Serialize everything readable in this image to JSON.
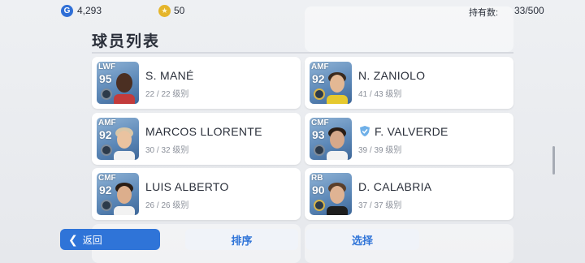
{
  "topbar": {
    "gp_icon": "G",
    "gp_value": "4,293",
    "coin_icon": "star-coin",
    "coin_value": "50",
    "holdings_label": "持有数:",
    "holdings_value": "33/500"
  },
  "title": "球员列表",
  "players": [
    {
      "pos": "LWF",
      "ovr": "95",
      "name": "S. MANÉ",
      "level": "22 / 22 级别",
      "badge": "silver"
    },
    {
      "pos": "AMF",
      "ovr": "92",
      "name": "N. ZANIOLO",
      "level": "41 / 43 级别",
      "badge": "gold"
    },
    {
      "pos": "AMF",
      "ovr": "92",
      "name": "MARCOS LLORENTE",
      "level": "30 / 32 级别",
      "badge": "silver"
    },
    {
      "pos": "CMF",
      "ovr": "93",
      "name": "F. VALVERDE",
      "level": "39 / 39 级别",
      "badge": "silver",
      "checked": true
    },
    {
      "pos": "CMF",
      "ovr": "92",
      "name": "LUIS ALBERTO",
      "level": "26 / 26 级别",
      "badge": "silver"
    },
    {
      "pos": "RB",
      "ovr": "90",
      "name": "D. CALABRIA",
      "level": "37 / 37 级别",
      "badge": "gold"
    }
  ],
  "buttons": {
    "back": "返回",
    "sort": "排序",
    "select": "选择"
  },
  "colors": {
    "accent": "#2f74d8",
    "card_bg": "#ffffff",
    "page_bg": "#e9ebef"
  }
}
